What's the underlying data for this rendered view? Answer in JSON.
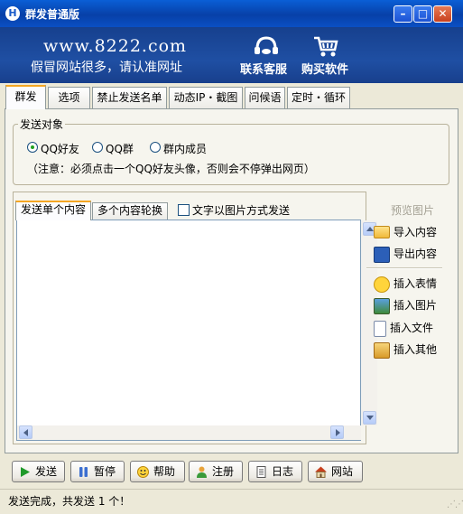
{
  "window": {
    "title": "群发普通版",
    "app_icon": "H"
  },
  "banner": {
    "url": "www.8222.com",
    "warning": "假冒网站很多，请认准网址",
    "support_label": "联系客服",
    "buy_label": "购买软件"
  },
  "tabs": [
    "群发",
    "选项",
    "禁止发送名单",
    "动态IP・截图",
    "问候语",
    "定时・循环"
  ],
  "target": {
    "legend": "发送对象",
    "options": [
      "QQ好友",
      "QQ群",
      "群内成员"
    ],
    "notice": "（注意：必须点击一个QQ好友头像，否则会不停弹出网页）"
  },
  "content": {
    "tabs": [
      "发送单个内容",
      "多个内容轮换"
    ],
    "image_checkbox": "文字以图片方式发送",
    "editor_value": ""
  },
  "side": {
    "preview": "预览图片",
    "import": "导入内容",
    "export": "导出内容",
    "emoji": "插入表情",
    "picture": "插入图片",
    "file": "插入文件",
    "other": "插入其他"
  },
  "buttons": [
    "发送",
    "暂停",
    "帮助",
    "注册",
    "日志",
    "网站"
  ],
  "status": "发送完成，共发送 1 个！"
}
